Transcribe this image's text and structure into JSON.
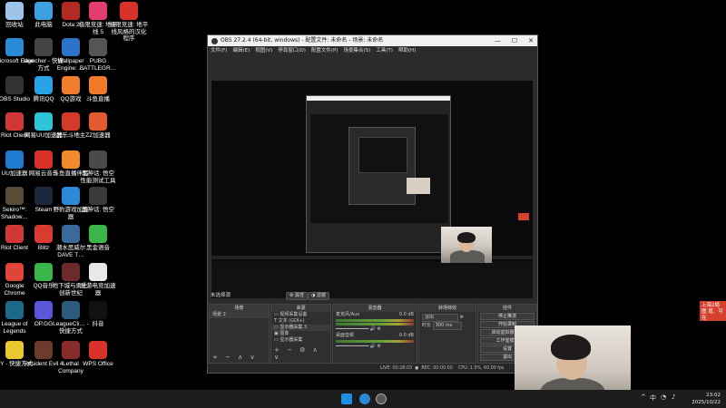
{
  "desktop": {
    "icons": [
      {
        "label": "回收站",
        "color": "#9ec5e8"
      },
      {
        "label": "Microsoft Edge",
        "color": "#2b8ad6"
      },
      {
        "label": "OBS Studio",
        "color": "#333333"
      },
      {
        "label": "Riot Client",
        "color": "#d13639"
      },
      {
        "label": "UU加速器",
        "color": "#1f7ad1"
      },
      {
        "label": "Sekiro™: Shadow…",
        "color": "#5a4a3a"
      },
      {
        "label": "Riot Client",
        "color": "#d13639"
      },
      {
        "label": "Google Chrome",
        "color": "#e0453a"
      },
      {
        "label": "League of Legends",
        "color": "#1b6a8a"
      },
      {
        "label": "YY - 快捷方式",
        "color": "#e8c730"
      },
      {
        "label": "此电脑",
        "color": "#3aa0e0"
      },
      {
        "label": "launcher - 快捷方式",
        "color": "#444444"
      },
      {
        "label": "腾讯QQ",
        "color": "#2aa3e6"
      },
      {
        "label": "网易UU加速器",
        "color": "#2ec3d8"
      },
      {
        "label": "网易云音乐",
        "color": "#d9322b"
      },
      {
        "label": "Steam",
        "color": "#1b2a3b"
      },
      {
        "label": "Blitz",
        "color": "#d83b2f"
      },
      {
        "label": "QQ音乐",
        "color": "#3bb54a"
      },
      {
        "label": "OP.GG",
        "color": "#5b57d8"
      },
      {
        "label": "Resident Evil 4",
        "color": "#6b3b2b"
      },
      {
        "label": "Dota 2",
        "color": "#b22b22"
      },
      {
        "label": "Wallpaper Engine: …",
        "color": "#2b72c8"
      },
      {
        "label": "QQ游戏",
        "color": "#ef7d2b"
      },
      {
        "label": "武乐斗地主",
        "color": "#d23a2a"
      },
      {
        "label": "斗鱼直播伴侣",
        "color": "#f08a2a"
      },
      {
        "label": "野豹游戏加速器",
        "color": "#2a8ad8"
      },
      {
        "label": "潮水思威尔 DAVE T…",
        "color": "#3a6a9a"
      },
      {
        "label": "地下城与勇士: 创新世纪",
        "color": "#6b2b2b"
      },
      {
        "label": "LeagueCli… - 快捷方式",
        "color": "#2b5a7a"
      },
      {
        "label": "Lethal Company",
        "color": "#8a2b2b"
      },
      {
        "label": "极限竞速: 地平线 5",
        "color": "#e33c6e"
      },
      {
        "label": "PUBG BATTLEGR…",
        "color": "#555555"
      },
      {
        "label": "斗鱼直播",
        "color": "#f07a2a"
      },
      {
        "label": "ZZ加速器",
        "color": "#e25a30"
      },
      {
        "label": "黑神话: 悟空 性能测试工具",
        "color": "#4a4a4a"
      },
      {
        "label": "黑神话: 悟空",
        "color": "#3a3a3a"
      },
      {
        "label": "黑金语音",
        "color": "#3ab54a"
      },
      {
        "label": "爱游电竞加速器",
        "color": "#e8e8e8"
      },
      {
        "label": "抖音",
        "color": "#111111"
      },
      {
        "label": "WPS Office",
        "color": "#d8322b"
      },
      {
        "label": "极限竞速: 地平线风格的汉化程序",
        "color": "#d8322b"
      }
    ]
  },
  "obs": {
    "title": "OBS 27.2.4 (64-bit, windows) - 配置文件: 未命名 - 场景: 未命名",
    "window_controls": [
      "—",
      "☐",
      "✕"
    ],
    "menu": [
      "文件(F)",
      "编辑(E)",
      "视图(V)",
      "停靠窗口(D)",
      "配置文件(P)",
      "场景集合(S)",
      "工具(T)",
      "帮助(H)"
    ],
    "no_source_label": "未选择源",
    "props_button": "属性",
    "filters_button": "滤镜",
    "docks": {
      "scenes": {
        "header": "场景",
        "items": [
          "场景 2"
        ]
      },
      "sources": {
        "header": "来源",
        "items": [
          "视频采集设备",
          "文本 (GDI+)",
          "显示器采集 3",
          "图像",
          "显示器采集"
        ]
      },
      "mixer": {
        "header": "混音器",
        "channels": [
          {
            "name": "麦克风/Aux",
            "db": "0.0 dB"
          },
          {
            "name": "桌面音频",
            "db": "0.0 dB"
          }
        ]
      },
      "transitions": {
        "header": "转场特效",
        "type": "淡出",
        "duration_label": "时长",
        "duration": "300 ms"
      },
      "controls": {
        "header": "控件",
        "buttons": [
          "停止推流",
          "开始录制",
          "启动虚拟摄像机",
          "工作室模式",
          "设置",
          "退出"
        ]
      }
    },
    "status": {
      "live": "LIVE: 00:28:03",
      "rec": "REC: 00:00:00",
      "cpu": "CPU: 1.5%, 60.00 fps"
    }
  },
  "notice": {
    "text": "上海2局图 增、可在"
  },
  "taskbar": {
    "tray": {
      "ime": "中",
      "time": "23:02",
      "date": "2025/10/22"
    }
  }
}
